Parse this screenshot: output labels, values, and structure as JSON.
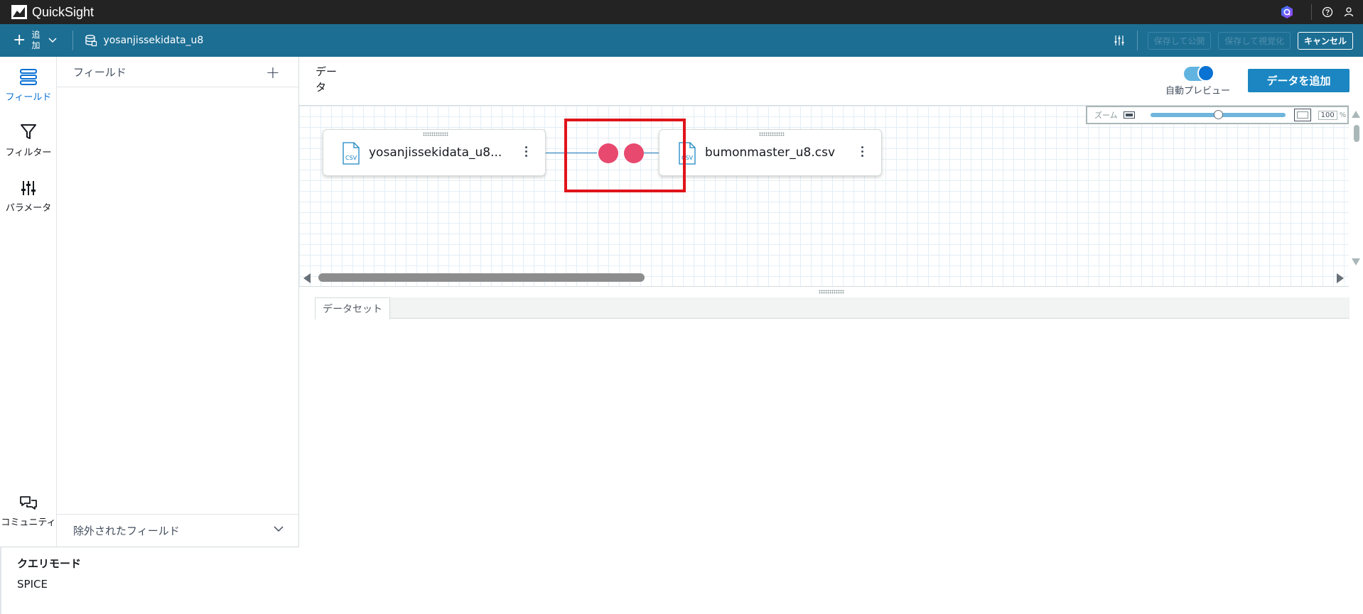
{
  "app": {
    "name": "QuickSight"
  },
  "toolbar": {
    "add_label": "追加",
    "dataset_name": "yosanjissekidata_u8",
    "publish_label": "保存して公開",
    "visualize_label": "保存して視覚化",
    "cancel_label": "キャンセル"
  },
  "rail": {
    "fields": "フィールド",
    "filters": "フィルター",
    "parameters": "パラメータ",
    "community": "コミュニティ"
  },
  "field_panel": {
    "title": "フィールド",
    "add_symbol": "+",
    "excluded_label": "除外されたフィールド"
  },
  "query_mode": {
    "title": "クエリモード",
    "value": "SPICE"
  },
  "main": {
    "data_label": "データ",
    "auto_preview_label": "自動プレビュー",
    "auto_preview_on": true,
    "add_data_label": "データを追加"
  },
  "zoom": {
    "label": "ズーム",
    "value": "100",
    "unit": "%",
    "level_fraction": 0.5
  },
  "nodes": [
    {
      "name": "yosanjissekidata_u8...",
      "type": "csv"
    },
    {
      "name": "bumonmaster_u8.csv",
      "type": "csv"
    }
  ],
  "join": {
    "color": "#e8496e",
    "highlight_color": "#e0141b"
  },
  "dataset_tab": {
    "label": "データセット"
  },
  "colors": {
    "toolbar": "#1c6e93",
    "topbar": "#232323",
    "accent": "#0972d3",
    "button": "#1b86c2"
  }
}
